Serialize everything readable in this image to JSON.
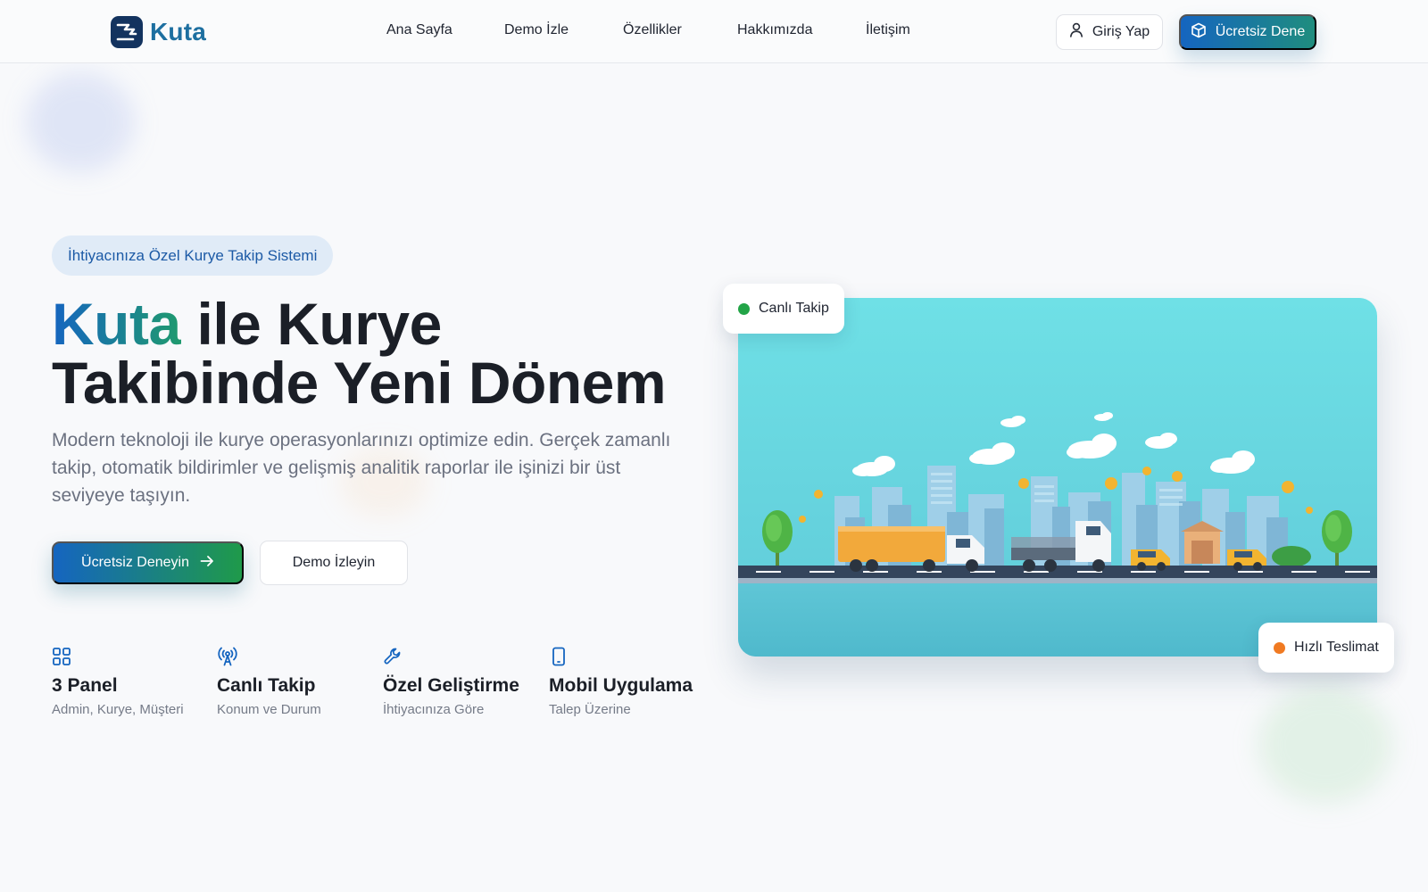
{
  "brand": {
    "name": "Kuta",
    "logo_icon": "kuta-logo-icon"
  },
  "nav": {
    "items": [
      {
        "label": "Ana Sayfa"
      },
      {
        "label": "Demo İzle"
      },
      {
        "label": "Özellikler"
      },
      {
        "label": "Hakkımızda"
      },
      {
        "label": "İletişim"
      }
    ],
    "login": {
      "label": "Giriş Yap",
      "icon": "user-icon"
    },
    "try": {
      "label": "Ücretsiz Dene",
      "icon": "cube-icon"
    }
  },
  "hero": {
    "tag": "İhtiyacınıza Özel Kurye Takip Sistemi",
    "title_brand": "Kuta",
    "title_line1_rest": " ile Kurye",
    "title_line2": "Takibinde Yeni Dönem",
    "description": "Modern teknoloji ile kurye operasyonlarınızı optimize edin. Gerçek zamanlı takip, otomatik bildirimler ve gelişmiş analitik raporlar ile işinizi bir üst seviyeye taşıyın.",
    "primary_cta": {
      "label": "Ücretsiz Deneyin",
      "icon": "arrow-right-icon"
    },
    "secondary_cta": {
      "label": "Demo İzleyin"
    }
  },
  "features": [
    {
      "icon": "grid-icon",
      "title": "3 Panel",
      "subtitle": "Admin, Kurye, Müşteri"
    },
    {
      "icon": "antenna-icon",
      "title": "Canlı Takip",
      "subtitle": "Konum ve Durum"
    },
    {
      "icon": "wrench-icon",
      "title": "Özel Geliştirme",
      "subtitle": "İhtiyacınıza Göre"
    },
    {
      "icon": "phone-icon",
      "title": "Mobil Uygulama",
      "subtitle": "Talep Üzerine"
    }
  ],
  "badges": {
    "live": {
      "label": "Canlı Takip",
      "color": "#22a447"
    },
    "fast": {
      "label": "Hızlı Teslimat",
      "color": "#f07a22"
    }
  },
  "colors": {
    "primary_blue": "#1565c0",
    "primary_green": "#1f9a4a",
    "brand_text": "#1d6fa0",
    "tag_bg": "#e0ebf7",
    "illustration_sky": "#6fd9e0"
  }
}
